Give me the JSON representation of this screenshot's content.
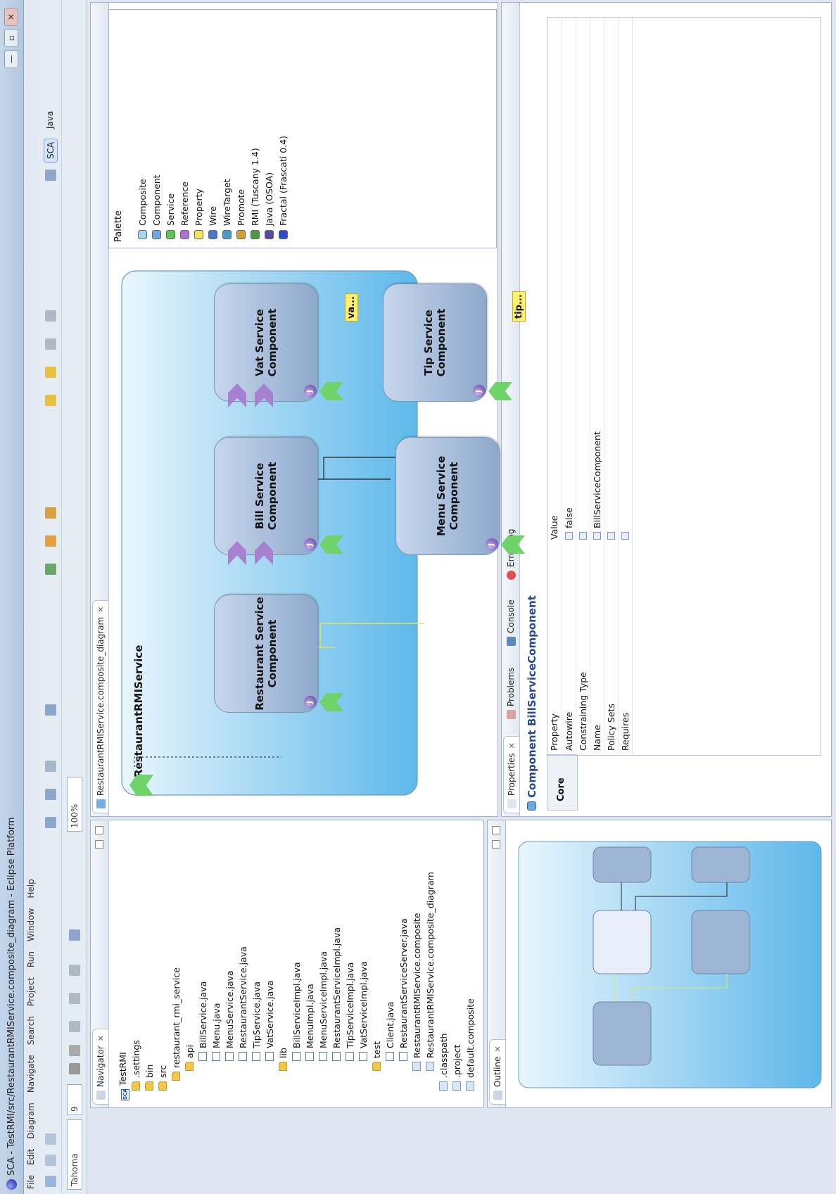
{
  "window": {
    "title": "SCA - TestRMI/src/RestaurantRMIService.composite_diagram - Eclipse Platform",
    "minimize": "—",
    "maximize": "▫",
    "close": "✕"
  },
  "menu": [
    "File",
    "Edit",
    "Diagram",
    "Navigate",
    "Search",
    "Project",
    "Run",
    "Window",
    "Help"
  ],
  "toolbar": {
    "font_name": "Tahoma",
    "font_size": "9",
    "zoom": "100%",
    "perspectives": [
      "SCA",
      "Java"
    ]
  },
  "navigator": {
    "tab": "Navigator",
    "items": [
      {
        "label": "TestRMI",
        "indent": 0,
        "icon": "project"
      },
      {
        "label": ".settings",
        "indent": 1,
        "icon": "folder"
      },
      {
        "label": "bin",
        "indent": 1,
        "icon": "folder"
      },
      {
        "label": "src",
        "indent": 1,
        "icon": "folder"
      },
      {
        "label": "restaurant_rmi_service",
        "indent": 2,
        "icon": "folder"
      },
      {
        "label": "api",
        "indent": 3,
        "icon": "folder"
      },
      {
        "label": "BillService.java",
        "indent": 4,
        "icon": "java"
      },
      {
        "label": "Menu.java",
        "indent": 4,
        "icon": "java"
      },
      {
        "label": "MenuService.java",
        "indent": 4,
        "icon": "java"
      },
      {
        "label": "RestaurantService.java",
        "indent": 4,
        "icon": "java"
      },
      {
        "label": "TipService.java",
        "indent": 4,
        "icon": "java"
      },
      {
        "label": "VatService.java",
        "indent": 4,
        "icon": "java"
      },
      {
        "label": "lib",
        "indent": 3,
        "icon": "folder"
      },
      {
        "label": "BillServiceImpl.java",
        "indent": 4,
        "icon": "java"
      },
      {
        "label": "MenuImpl.java",
        "indent": 4,
        "icon": "java"
      },
      {
        "label": "MenuServiceImpl.java",
        "indent": 4,
        "icon": "java"
      },
      {
        "label": "RestaurantServiceImpl.java",
        "indent": 4,
        "icon": "java"
      },
      {
        "label": "TipServiceImpl.java",
        "indent": 4,
        "icon": "java"
      },
      {
        "label": "VatServiceImpl.java",
        "indent": 4,
        "icon": "java"
      },
      {
        "label": "test",
        "indent": 3,
        "icon": "folder"
      },
      {
        "label": "Client.java",
        "indent": 4,
        "icon": "java"
      },
      {
        "label": "RestaurantServiceServer.java",
        "indent": 4,
        "icon": "java"
      },
      {
        "label": "RestaurantRMIService.composite",
        "indent": 3,
        "icon": "file"
      },
      {
        "label": "RestaurantRMIService.composite_diagram",
        "indent": 3,
        "icon": "file"
      },
      {
        "label": ".classpath",
        "indent": 1,
        "icon": "file"
      },
      {
        "label": ".project",
        "indent": 1,
        "icon": "file"
      },
      {
        "label": "default.composite",
        "indent": 1,
        "icon": "file"
      }
    ]
  },
  "outline": {
    "tab": "Outline"
  },
  "editor": {
    "tab": "RestaurantRMIService.composite_diagram",
    "composite_name": "RestaurantRMIService",
    "components": {
      "restaurant": "Restaurant Service Component",
      "bill": "Bill Service Component",
      "menu": "Menu Service Component",
      "vat": "Vat Service Component",
      "tip": "Tip Service Component"
    },
    "notes": {
      "vat": "va...",
      "tip": "tip..."
    }
  },
  "palette": {
    "title": "Palette",
    "items": [
      {
        "label": "Composite",
        "color": "#9fd8f0"
      },
      {
        "label": "Component",
        "color": "#6fa8e0"
      },
      {
        "label": "Service",
        "color": "#5cc454"
      },
      {
        "label": "Reference",
        "color": "#b070d8"
      },
      {
        "label": "Property",
        "color": "#f4e45a"
      },
      {
        "label": "Wire",
        "color": "#4a78c8"
      },
      {
        "label": "WireTarget",
        "color": "#4a9ad0"
      },
      {
        "label": "Promote",
        "color": "#d0a030"
      },
      {
        "label": "RMI (Tuscany 1.4)",
        "color": "#4a9a4a"
      },
      {
        "label": "Java (OSOA)",
        "color": "#5a4aa8"
      },
      {
        "label": "Fractal (Frascati 0.4)",
        "color": "#2a4ad0"
      }
    ]
  },
  "bottom_tabs": [
    "Properties",
    "Problems",
    "Console",
    "Error Log"
  ],
  "properties": {
    "header": "Component BillServiceComponent",
    "section": "Core",
    "columns": [
      "Property",
      "Value"
    ],
    "rows": [
      {
        "property": "Autowire",
        "value": "false"
      },
      {
        "property": "Constraining Type",
        "value": ""
      },
      {
        "property": "Name",
        "value": "BillServiceComponent"
      },
      {
        "property": "Policy Sets",
        "value": ""
      },
      {
        "property": "Requires",
        "value": ""
      }
    ]
  },
  "colors": {
    "composite_bg_start": "#5db8ea",
    "composite_bg_end": "#e9f6fd",
    "service_green": "#6fd36a",
    "reference_purple": "#a681cf",
    "wire_yellow": "#dcea55"
  }
}
